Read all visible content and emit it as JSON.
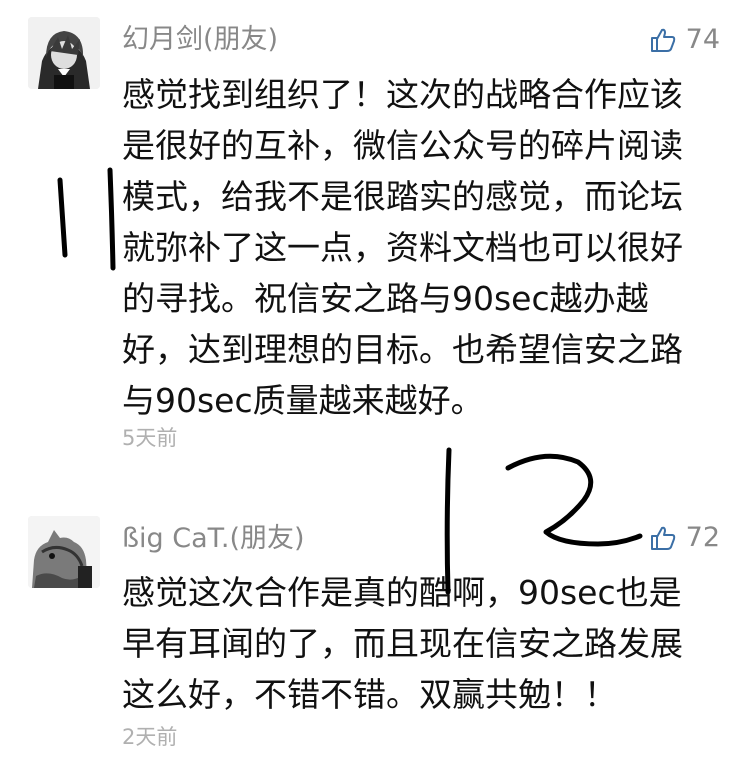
{
  "comments": [
    {
      "author": "幻月剑(朋友)",
      "likes": "74",
      "lines": [
        "感觉找到组织了！这次的战略合作应该",
        "是很好的互补，微信公众号的碎片阅读",
        "模式，给我不是很踏实的感觉，而论坛",
        "就弥补了这一点，资料文档也可以很好",
        "的寻找。祝信安之路与90sec越办越",
        "好，达到理想的目标。也希望信安之路",
        "与90sec质量越来越好。"
      ],
      "time": "5天前"
    },
    {
      "author": "ßig CaT.(朋友)",
      "likes": "72",
      "lines": [
        "感觉这次合作是真的酷啊，90sec也是",
        "早有耳闻的了，而且现在信安之路发展",
        "这么好，不错不错。双赢共勉！！"
      ],
      "time": "2天前"
    }
  ],
  "colors": {
    "meta": "#888888",
    "text": "#111111",
    "time": "#b0b0b0",
    "ink": "#000000"
  },
  "icons": {
    "like": "thumbs-up-icon"
  }
}
